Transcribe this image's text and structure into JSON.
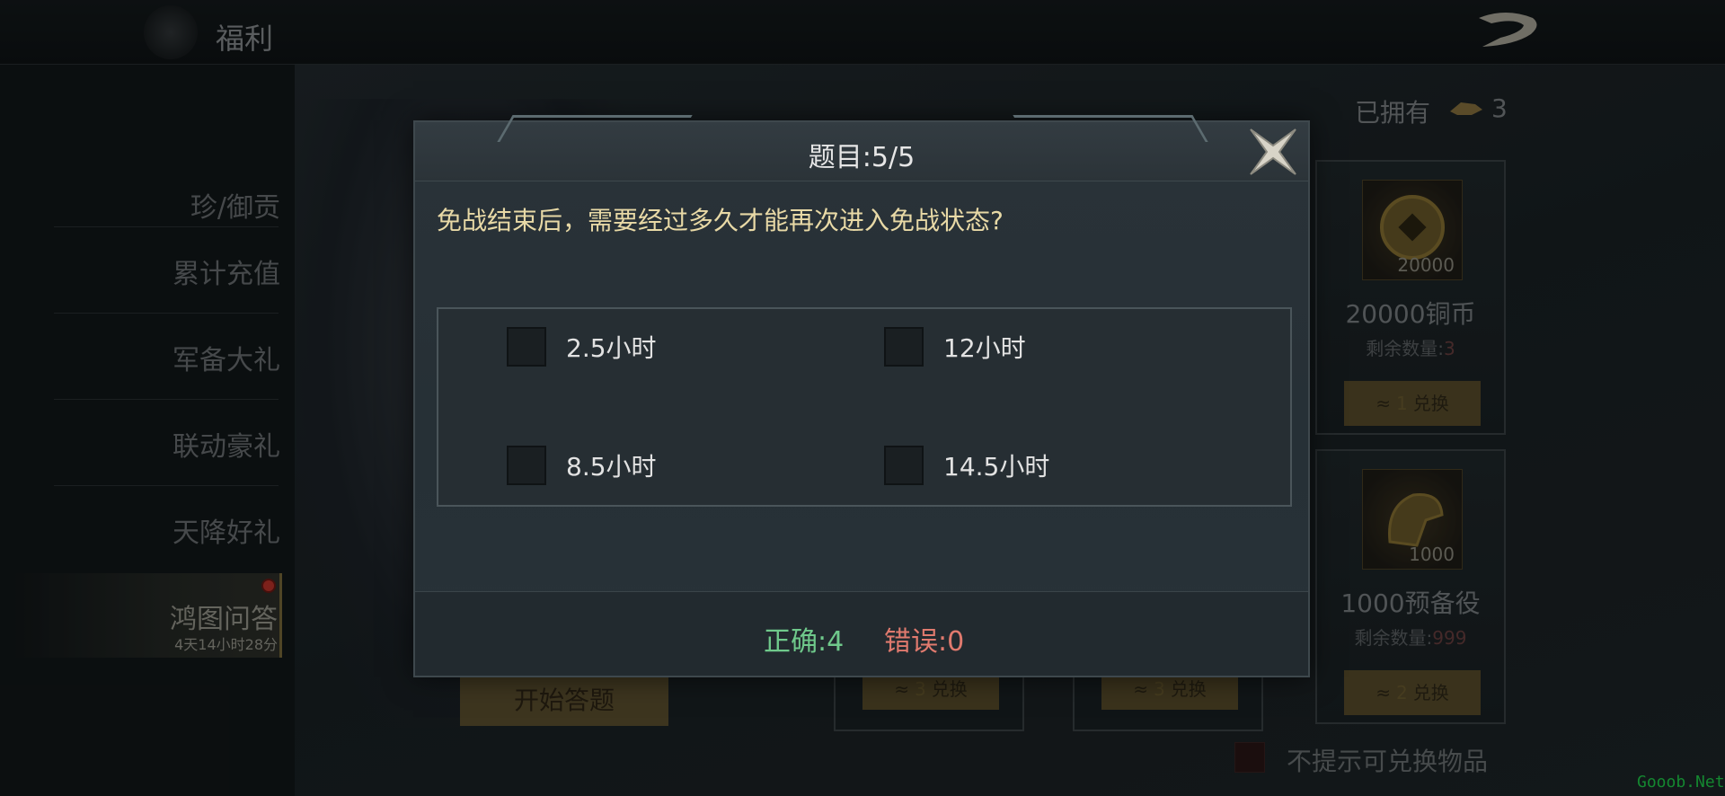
{
  "topbar": {
    "title": "福利",
    "back_icon": "dragon-back-icon"
  },
  "sidebar": {
    "items": [
      {
        "label": "珍/御贡"
      },
      {
        "label": "累计充值"
      },
      {
        "label": "军备大礼"
      },
      {
        "label": "联动豪礼"
      },
      {
        "label": "天降好礼"
      },
      {
        "label": "鸿图问答",
        "sub": "4天14小时28分",
        "active": true
      }
    ]
  },
  "main": {
    "owned_label": "已拥有",
    "owned_count": "3",
    "start_button": "开始答题",
    "no_remind_label": "不提示可兑换物品",
    "cards": [
      {
        "qty": "20000",
        "name": "20000铜币",
        "remain_label": "剩余数量:",
        "remain_value": "3",
        "cost": "1",
        "exchange": "兑换"
      },
      {
        "qty": "1000",
        "name": "1000预备役",
        "remain_label": "剩余数量:",
        "remain_value": "999",
        "cost": "2",
        "exchange": "兑换"
      }
    ],
    "mini_cards": [
      {
        "cost": "3",
        "exchange": "兑换"
      },
      {
        "cost": "3",
        "exchange": "兑换"
      }
    ]
  },
  "quiz": {
    "title": "题目:5/5",
    "question": "免战结束后，需要经过多久才能再次进入免战状态?",
    "options": [
      {
        "label": "2.5小时"
      },
      {
        "label": "12小时"
      },
      {
        "label": "8.5小时"
      },
      {
        "label": "14.5小时"
      }
    ],
    "correct_label": "正确:4",
    "wrong_label": "错误:0"
  },
  "watermark": "Gooob.Net"
}
